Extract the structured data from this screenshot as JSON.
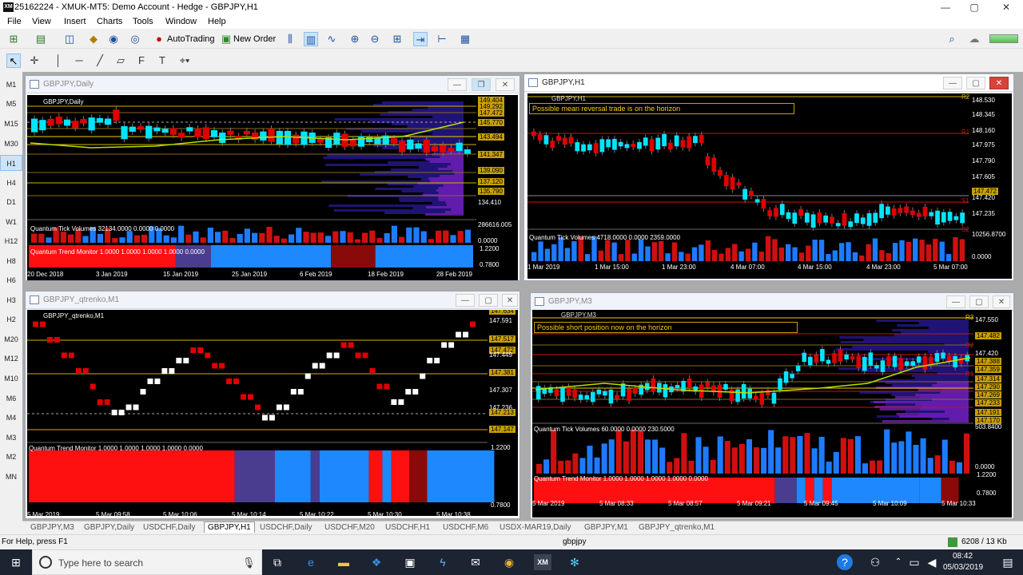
{
  "app": {
    "title": "25162224 - XMUK-MT5: Demo Account - Hedge - GBPJPY,H1",
    "icon_text": "XM"
  },
  "window_controls": {
    "minimize": "—",
    "maximize": "▢",
    "close": "✕"
  },
  "menu": [
    "File",
    "View",
    "Insert",
    "Charts",
    "Tools",
    "Window",
    "Help"
  ],
  "toolbar": {
    "autotrading_label": "AutoTrading",
    "new_order_label": "New Order"
  },
  "timeframes": [
    "M1",
    "M5",
    "M15",
    "M30",
    "H1",
    "H4",
    "D1",
    "W1",
    "H12",
    "H8",
    "H6",
    "H3",
    "H2",
    "M20",
    "M12",
    "M10",
    "M6",
    "M4",
    "M3",
    "M2",
    "MN"
  ],
  "selected_timeframe": "H1",
  "windows": {
    "daily": {
      "title": "GBPJPY,Daily",
      "inner_label": "GBPJPY,Daily",
      "tick_volume_label": "Quantum Tick Volumes 32134.0000 0.0000 0.0000",
      "trend_monitor_label": "Quantum Trend Monitor 1.0000 1.0000 1.0000 1.0000 0.0000",
      "price_labels": [
        "149.404",
        "149.292",
        "147.472",
        "145.770",
        "143.494",
        "141.347",
        "139.090",
        "137.120",
        "135.790",
        "134.410"
      ],
      "volume_labels": [
        "286616.005",
        "0.0000"
      ],
      "trend_labels": [
        "1.2200",
        "0.7800"
      ],
      "x_labels": [
        "20 Dec 2018",
        "3 Jan 2019",
        "15 Jan 2019",
        "25 Jan 2019",
        "6 Feb 2019",
        "18 Feb 2019",
        "28 Feb 2019"
      ]
    },
    "h1": {
      "title": "GBPJPY,H1",
      "inner_label": "GBPJPY,H1",
      "annotation": "Possible mean reversal trade is on the horizon",
      "tick_volume_label": "Quantum Tick Volumes 4718.0000 0.0000 2359.0000",
      "price_labels": [
        "148.530",
        "148.345",
        "148.160",
        "147.975",
        "147.790",
        "147.605",
        "147.472",
        "147.420",
        "147.235"
      ],
      "pivot_labels": [
        "R2",
        "R1",
        "S1",
        "S2"
      ],
      "volume_labels": [
        "10256.8700",
        "0.0000"
      ],
      "x_labels": [
        "1 Mar 2019",
        "1 Mar 15:00",
        "1 Mar 23:00",
        "4 Mar 07:00",
        "4 Mar 15:00",
        "4 Mar 23:00",
        "5 Mar 07:00"
      ]
    },
    "qtrenko": {
      "title": "GBPJPY_qtrenko,M1",
      "inner_label": "GBPJPY_qtrenko,M1",
      "trend_monitor_label": "Quantum Trend Monitor 1.0000 1.0000 1.0000 1.0000 0.0000",
      "price_labels": [
        "147.634",
        "147.591",
        "147.517",
        "147.472",
        "147.449",
        "147.381",
        "147.307",
        "147.236",
        "147.213",
        "147.147"
      ],
      "trend_labels": [
        "1.2200",
        "0.7800"
      ],
      "x_labels": [
        "5 Mar 2019",
        "5 Mar 09:58",
        "5 Mar 10:06",
        "5 Mar 10:14",
        "5 Mar 10:22",
        "5 Mar 10:30",
        "5 Mar 10:38"
      ]
    },
    "m3": {
      "title": "GBPJPY,M3",
      "inner_label": "GBPJPY,M3",
      "annotation": "Possible short position now on the horizon",
      "tick_volume_label": "Quantum Tick Volumes 60.0000 0.0000 230.5000",
      "trend_monitor_label": "Quantum Trend Monitor 1.0000 1.0000 1.0000 1.0000 0.0000",
      "price_labels": [
        "147.550",
        "147.482",
        "147.420",
        "147.388",
        "147.359",
        "147.314",
        "147.290",
        "147.269",
        "147.233",
        "147.191",
        "147.170"
      ],
      "pivot_labels": [
        "R3",
        "R2",
        "R1"
      ],
      "volume_labels": [
        "503.8400",
        "0.0000"
      ],
      "trend_labels": [
        "1.2200",
        "0.7800"
      ],
      "x_labels": [
        "5 Mar 2019",
        "5 Mar 08:33",
        "5 Mar 08:57",
        "5 Mar 09:21",
        "5 Mar 09:45",
        "5 Mar 10:09",
        "5 Mar 10:33"
      ]
    }
  },
  "tabs": [
    "GBPJPY,M3",
    "GBPJPY,Daily",
    "USDCHF,Daily",
    "GBPJPY,H1",
    "USDCHF,Daily",
    "USDCHF,M20",
    "USDCHF,H1",
    "USDCHF,M6",
    "USDX-MAR19,Daily",
    "GBPJPY,M1",
    "GBPJPY_qtrenko,M1"
  ],
  "selected_tab": "GBPJPY,H1",
  "status": {
    "help": "For Help, press F1",
    "profile": "gbpjpy",
    "traffic": "6208 / 13 Kb"
  },
  "taskbar": {
    "search_placeholder": "Type here to search",
    "time": "08:42",
    "date": "05/03/2019"
  },
  "colors": {
    "bull": "#00e5ff",
    "bear": "#e00000",
    "gold": "#c8a000",
    "volume_blue": "#1e7bff",
    "volume_red": "#d01010",
    "trend_red": "#ff1010",
    "trend_blue": "#1e88ff",
    "trend_navy": "#4a3d8f",
    "trend_maroon": "#8a0a0a"
  }
}
